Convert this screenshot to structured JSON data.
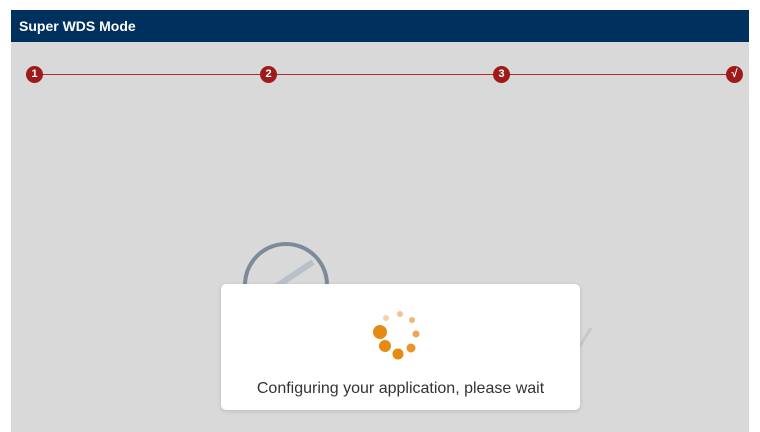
{
  "window": {
    "title": "Super WDS Mode"
  },
  "wizard": {
    "steps": [
      "1",
      "2",
      "3",
      "√"
    ],
    "colors": {
      "step": "#9e1b1b",
      "line": "#b02a2a"
    }
  },
  "modal": {
    "message": "Configuring your application, please wait",
    "spinner_icon": "loading-spinner-icon"
  },
  "colors": {
    "titlebar": "#00305e",
    "spinner": "#e58a13",
    "background": "#d9d9d9"
  }
}
